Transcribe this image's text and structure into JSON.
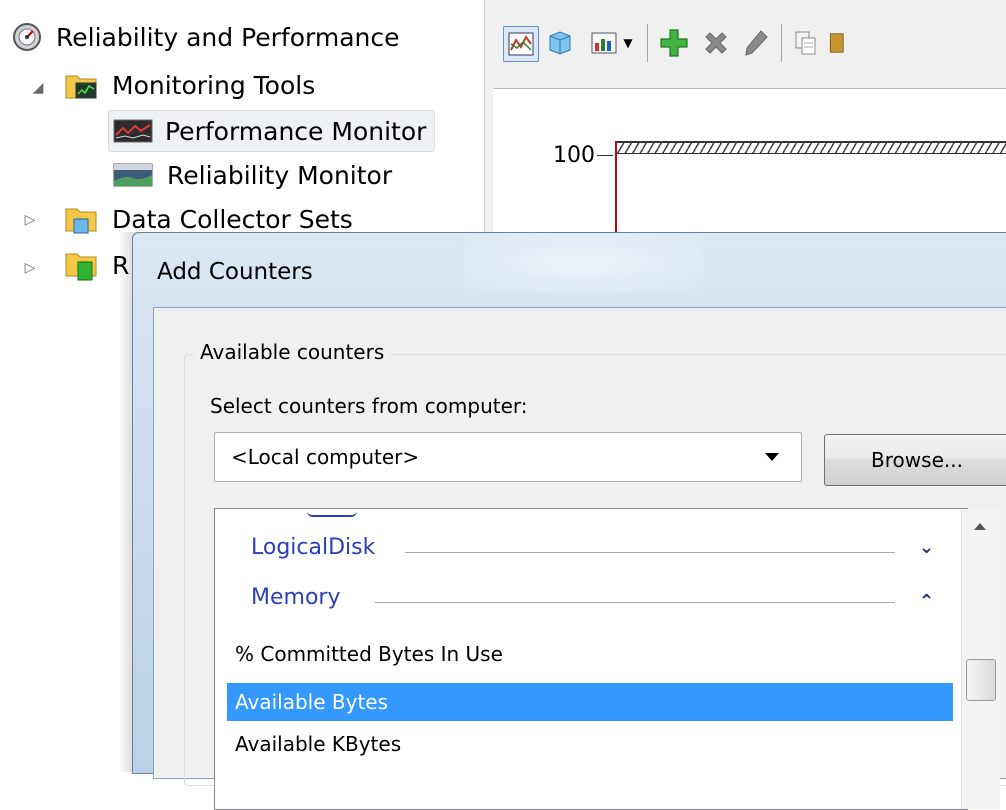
{
  "tree": {
    "items": [
      {
        "label": "Reliability and Performance",
        "icon": "gauge-icon"
      },
      {
        "label": "Monitoring Tools",
        "icon": "folder-monitor-icon",
        "expanded": true
      },
      {
        "label": "Performance Monitor",
        "icon": "performance-monitor-icon",
        "selected": true
      },
      {
        "label": "Reliability Monitor",
        "icon": "reliability-monitor-icon"
      },
      {
        "label": "Data Collector Sets",
        "icon": "folder-datacollector-icon",
        "expanded": false
      },
      {
        "label": "R",
        "icon": "folder-reports-icon",
        "expanded": false
      }
    ]
  },
  "toolbar": {
    "buttons": [
      "view-graph-icon",
      "freeze-display-icon",
      "change-graph-type-icon",
      "dropdown-icon",
      "add-counter-icon",
      "delete-counter-icon",
      "highlight-icon",
      "copy-properties-icon",
      "paste-icon"
    ]
  },
  "graph": {
    "y_max_label": "100"
  },
  "dialog": {
    "title": "Add Counters",
    "group_label": "Available counters",
    "select_label": "Select counters from computer:",
    "computer_value": "<Local computer>",
    "browse_label": "Browse...",
    "categories": [
      {
        "name": "LogicalDisk",
        "expanded": false
      },
      {
        "name": "Memory",
        "expanded": true
      }
    ],
    "counters": [
      {
        "name": "% Committed Bytes In Use",
        "selected": false
      },
      {
        "name": "Available Bytes",
        "selected": true
      },
      {
        "name": "Available KBytes",
        "selected": false
      }
    ]
  },
  "colors": {
    "selection": "#3399ff",
    "category_text": "#2b3fb8",
    "graph_axis": "#d00000"
  }
}
